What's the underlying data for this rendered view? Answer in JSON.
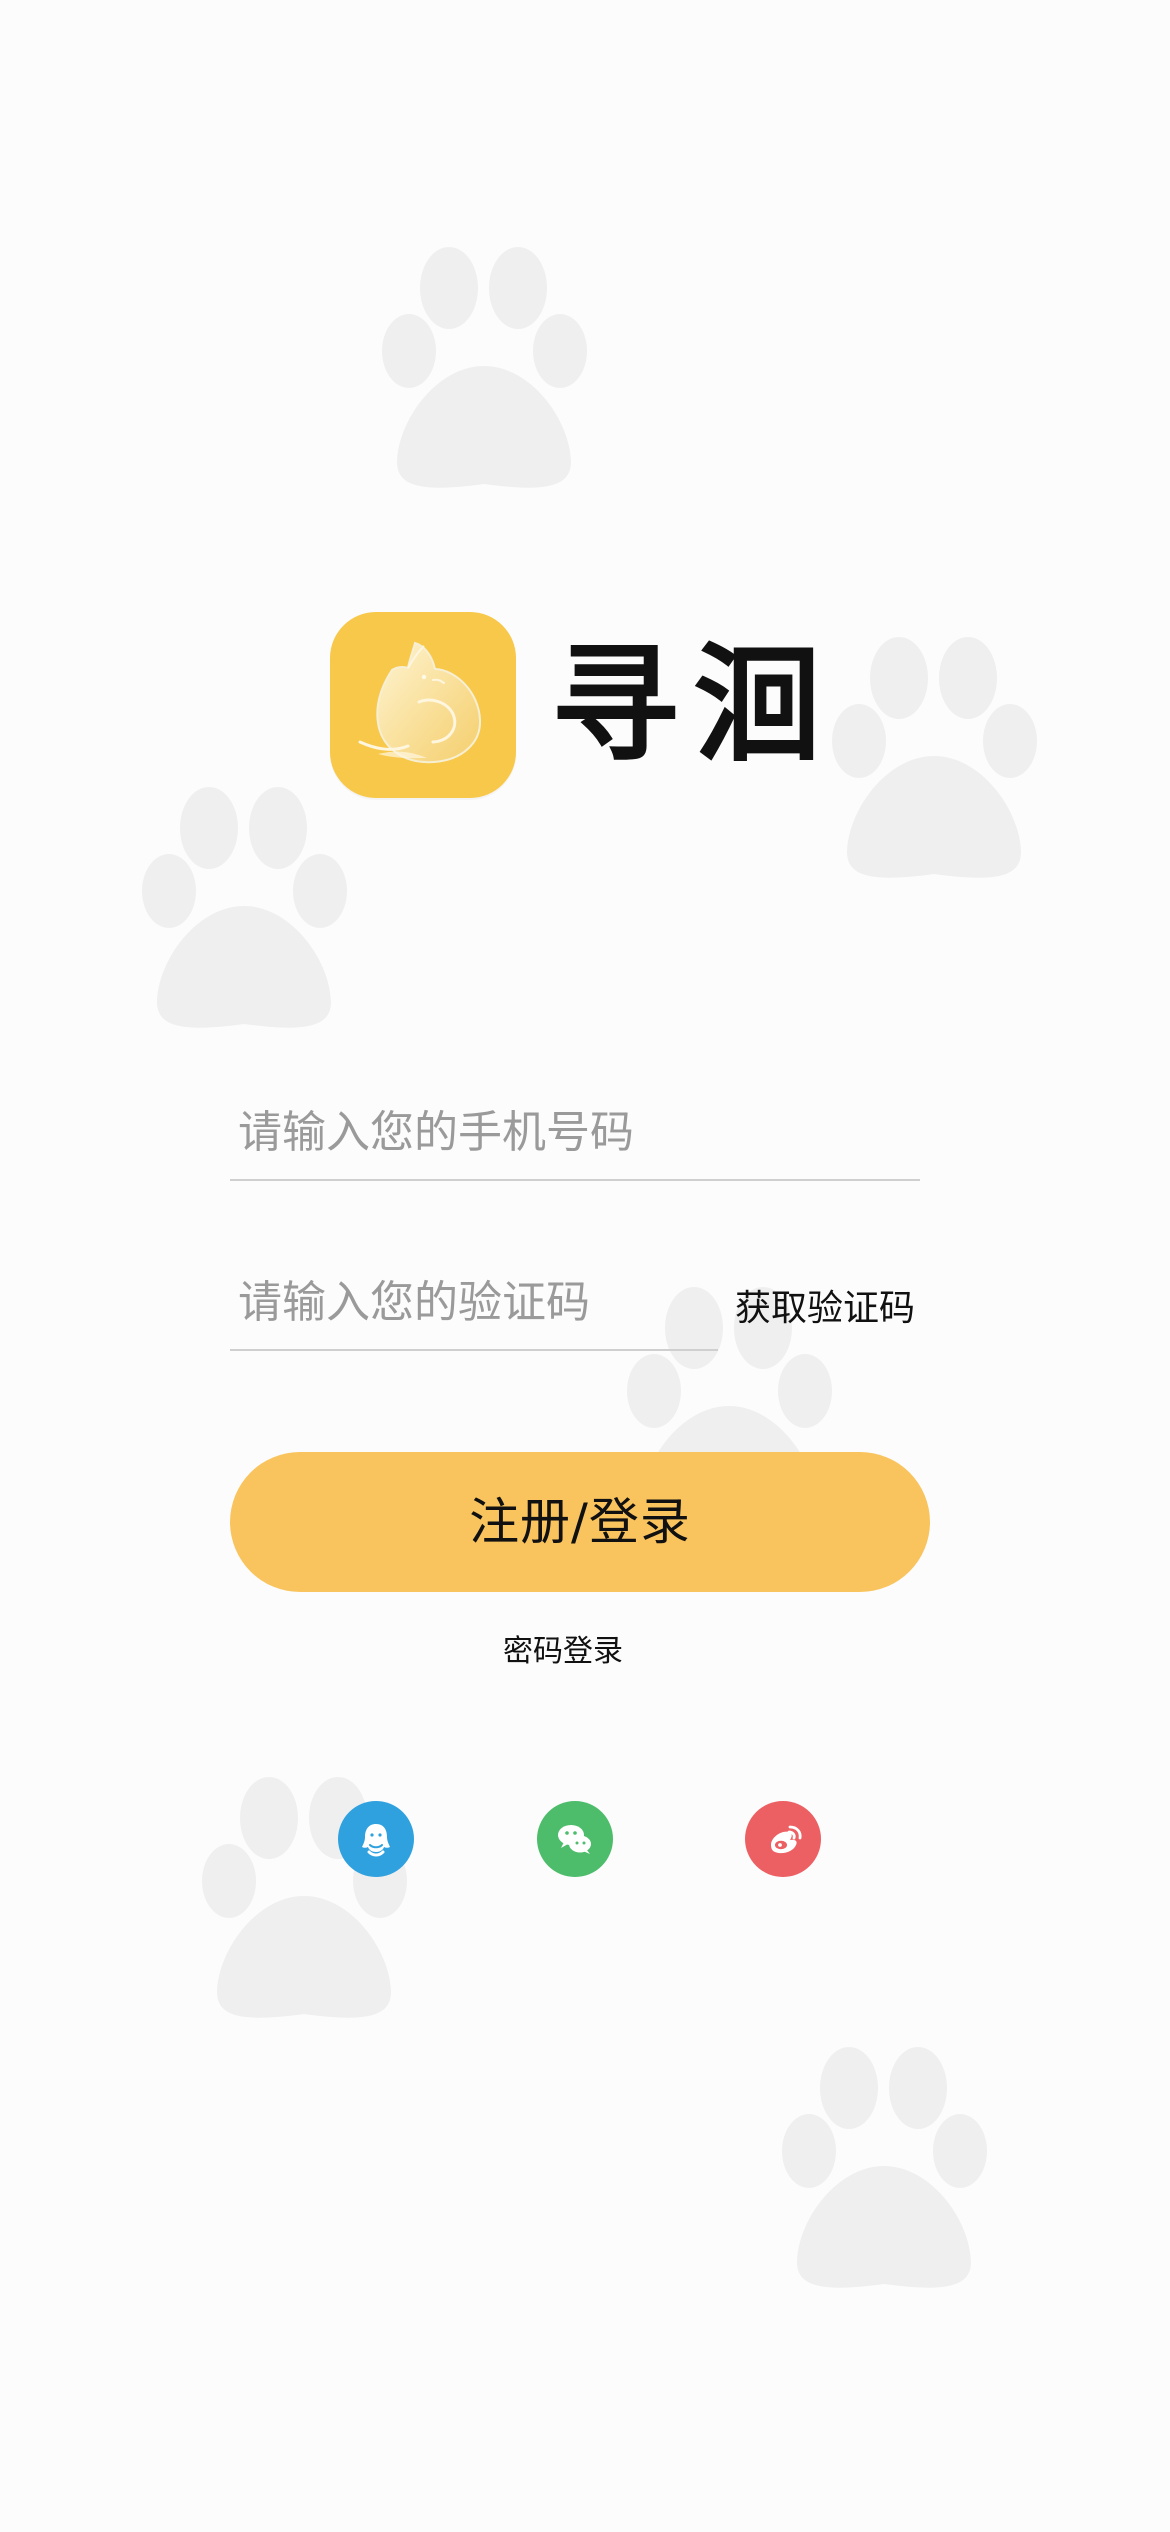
{
  "app": {
    "name": "寻洄",
    "icon_name": "sleeping-cat-app-icon",
    "brand_color": "#f8c84a"
  },
  "form": {
    "phone": {
      "value": "",
      "placeholder": "请输入您的手机号码"
    },
    "verification_code": {
      "value": "",
      "placeholder": "请输入您的验证码"
    },
    "get_code_label": "获取验证码",
    "submit_label": "注册/登录",
    "password_login_label": "密码登录"
  },
  "social_login": [
    {
      "name": "qq",
      "icon": "qq-icon",
      "color": "#2fa1df"
    },
    {
      "name": "wechat",
      "icon": "wechat-icon",
      "color": "#4dbd6b"
    },
    {
      "name": "weibo",
      "icon": "weibo-icon",
      "color": "#ec5f62"
    }
  ],
  "background": {
    "decorative_icon": "paw-print-icon",
    "paw_color": "#efefef"
  }
}
